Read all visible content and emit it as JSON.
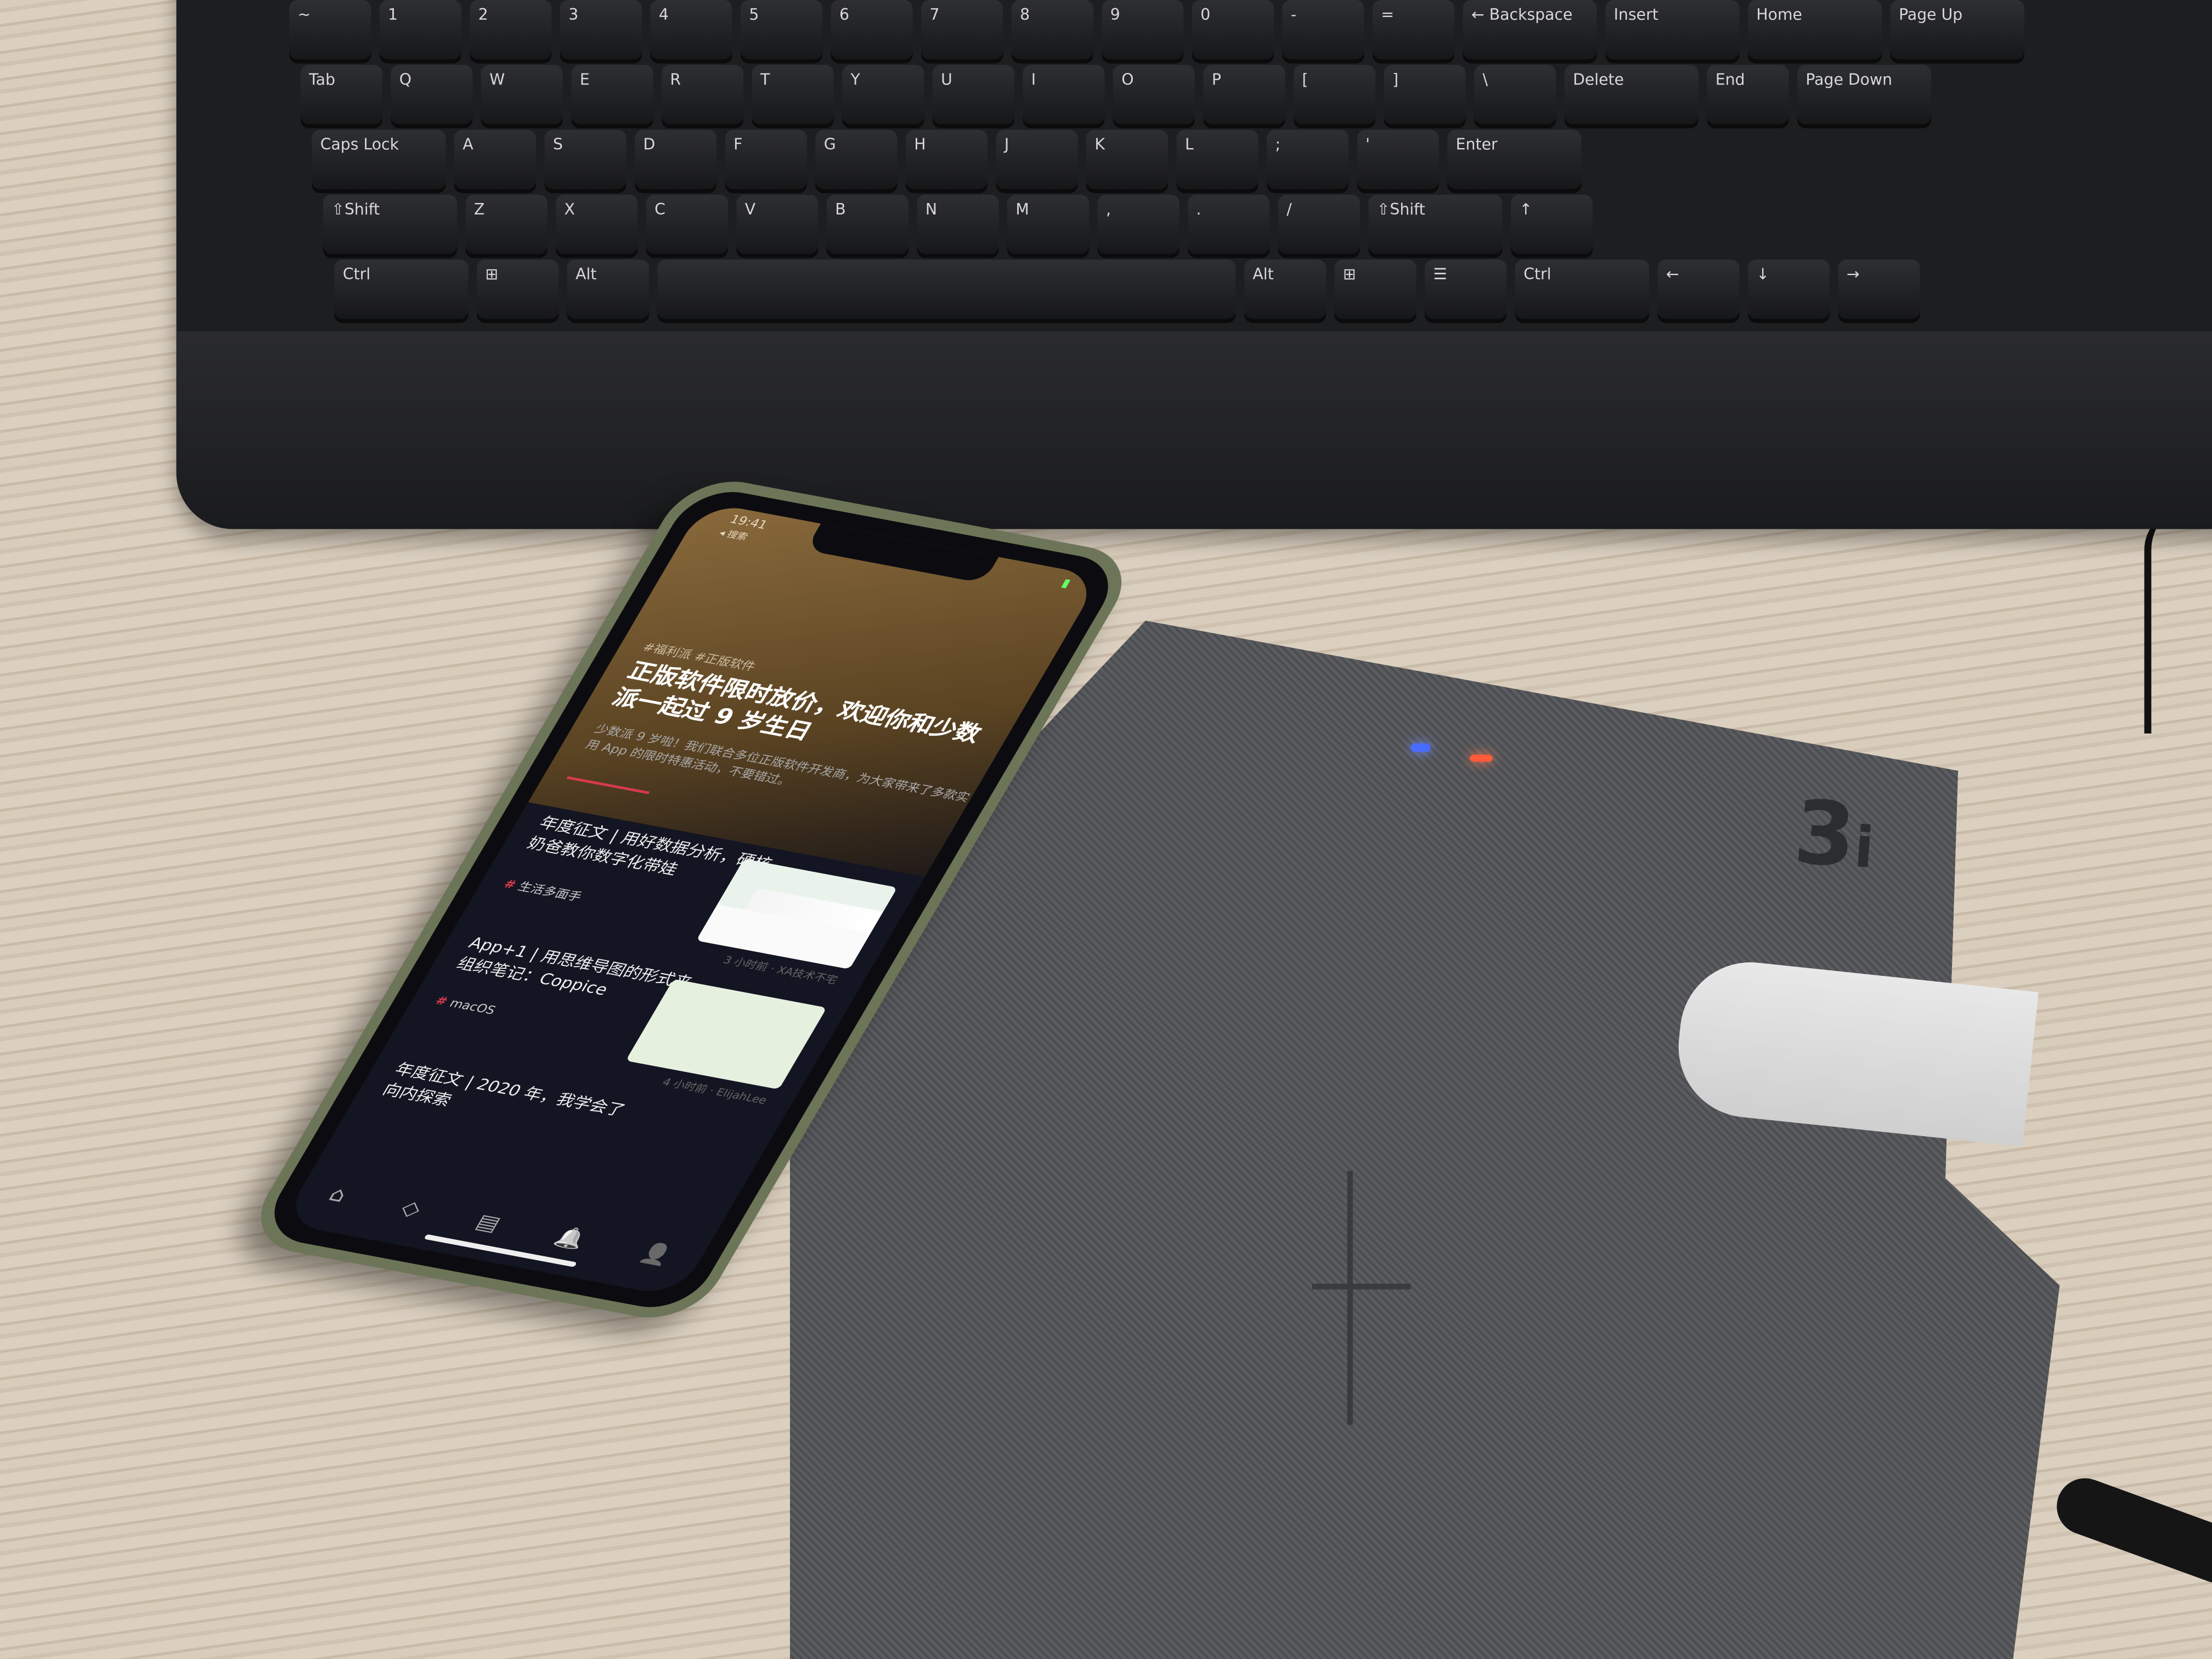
{
  "keyboard": {
    "rows": [
      [
        "~",
        "1",
        "2",
        "3",
        "4",
        "5",
        "6",
        "7",
        "8",
        "9",
        "0",
        "-",
        "=",
        "← Backspace",
        "Insert",
        "Home",
        "Page Up"
      ],
      [
        "Tab",
        "Q",
        "W",
        "E",
        "R",
        "T",
        "Y",
        "U",
        "I",
        "O",
        "P",
        "[",
        "]",
        "\\",
        "Delete",
        "End",
        "Page Down"
      ],
      [
        "Caps Lock",
        "A",
        "S",
        "D",
        "F",
        "G",
        "H",
        "J",
        "K",
        "L",
        ";",
        "'",
        "Enter"
      ],
      [
        "⇧Shift",
        "Z",
        "X",
        "C",
        "V",
        "B",
        "N",
        "M",
        ",",
        ".",
        "/",
        "⇧Shift",
        "↑"
      ],
      [
        "Ctrl",
        "⊞",
        "Alt",
        "",
        "Alt",
        "⊞",
        "☰",
        "Ctrl",
        "←",
        "↓",
        "→"
      ]
    ]
  },
  "charger": {
    "logo": "3i",
    "led_colors": [
      "#4a6bff",
      "#ff5a3a"
    ]
  },
  "phone": {
    "status": {
      "time": "19:41",
      "back": "◂ 搜索"
    },
    "hero": {
      "tags": "#福利派 #正版软件",
      "title": "正版软件限时放价，欢迎你和少数派一起过 9 岁生日",
      "description": "少数派 9 岁啦！我们联合多位正版软件开发商，为大家带来了多款实用 App 的限时特惠活动，不要错过。"
    },
    "articles": [
      {
        "title": "年度征文 | 用好数据分析，硬核奶爸教你数字化带娃",
        "tag": "生活多面手",
        "meta": "3 小时前 · XA技术不宅"
      },
      {
        "title": "App+1 | 用思维导图的形式来组织笔记：Coppice",
        "tag": "macOS",
        "meta": "4 小时前 · ElijahLee"
      },
      {
        "title": "年度征文 | 2020 年，我学会了向内探索",
        "tag": "",
        "meta": ""
      }
    ],
    "tabbar": [
      {
        "icon": "home-icon",
        "glyph": "⌂"
      },
      {
        "icon": "explore-icon",
        "glyph": "◇"
      },
      {
        "icon": "document-icon",
        "glyph": "▤"
      },
      {
        "icon": "bell-icon",
        "glyph": "🔔"
      },
      {
        "icon": "profile-icon",
        "glyph": "👤"
      }
    ],
    "accent": "#d63b4a"
  }
}
